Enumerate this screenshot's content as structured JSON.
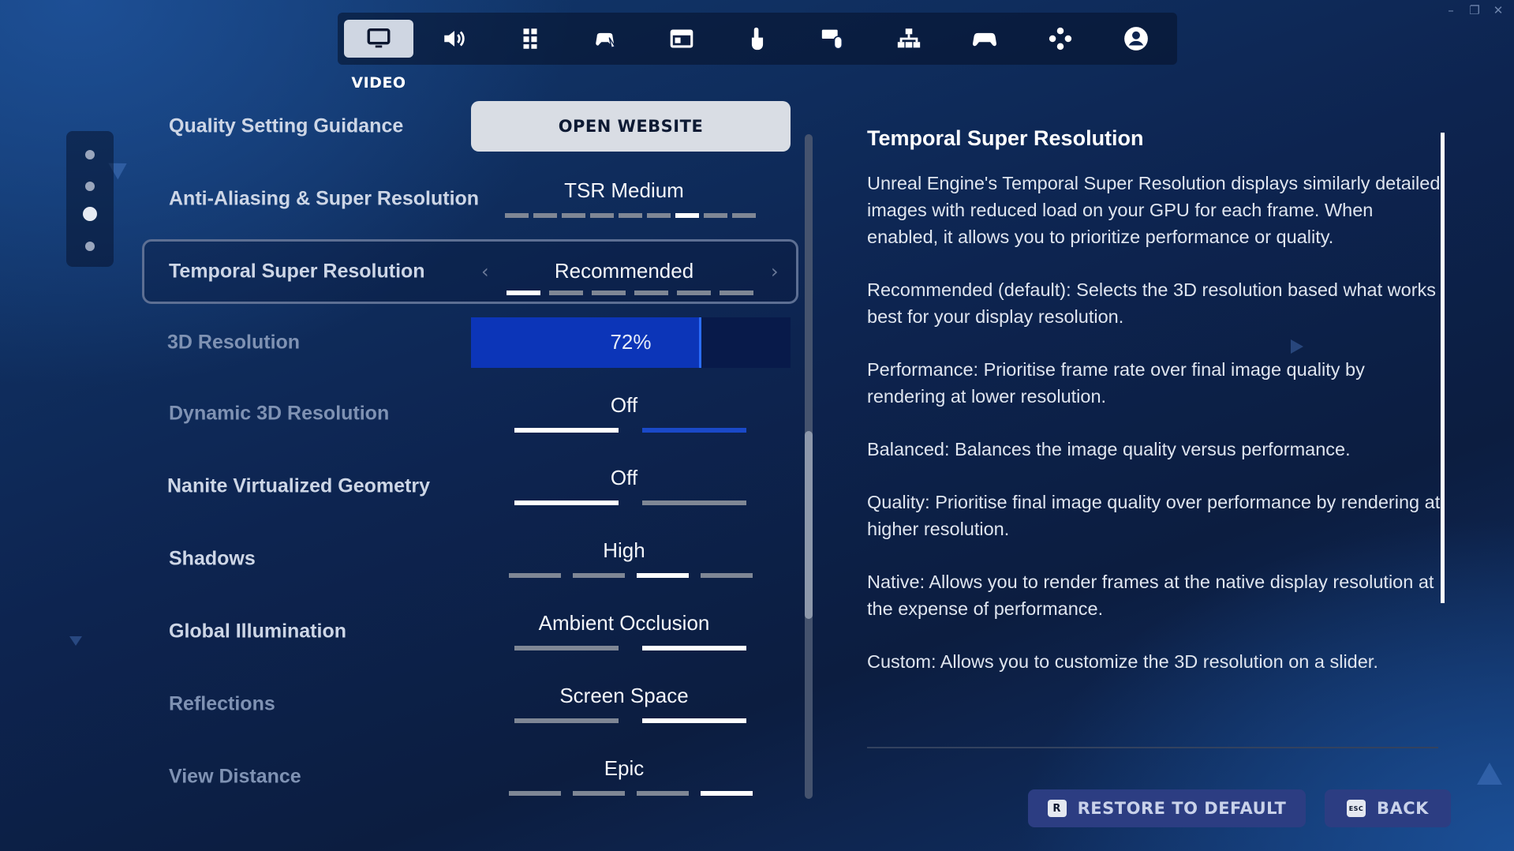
{
  "window": {
    "minimize_glyph": "–",
    "restore_glyph": "❐",
    "close_glyph": "✕"
  },
  "tabs": [
    {
      "icon": "monitor-icon",
      "active": true
    },
    {
      "icon": "speaker-icon"
    },
    {
      "icon": "accessibility-grid-icon"
    },
    {
      "icon": "gamepad-touch-icon"
    },
    {
      "icon": "window-panel-icon"
    },
    {
      "icon": "touch-hand-icon"
    },
    {
      "icon": "keyboard-mouse-icon"
    },
    {
      "icon": "network-icon"
    },
    {
      "icon": "controller-icon"
    },
    {
      "icon": "controller-dpad-icon"
    },
    {
      "icon": "account-icon"
    }
  ],
  "active_tab_label": "VIDEO",
  "settings": {
    "quality_guidance": {
      "label": "Quality Setting Guidance",
      "button": "OPEN WEBSITE"
    },
    "anti_aliasing": {
      "label": "Anti-Aliasing & Super Resolution",
      "value": "TSR Medium",
      "options": 9,
      "selected": 6
    },
    "tsr": {
      "label": "Temporal Super Resolution",
      "value": "Recommended",
      "options": 6,
      "selected": 0
    },
    "resolution_3d": {
      "label": "3D Resolution",
      "value": "72%",
      "percent": 72
    },
    "dynamic_3d": {
      "label": "Dynamic 3D Resolution",
      "value": "Off",
      "options": 2,
      "selected": 0
    },
    "nanite": {
      "label": "Nanite Virtualized Geometry",
      "value": "Off",
      "options": 2,
      "selected": 0
    },
    "shadows": {
      "label": "Shadows",
      "value": "High",
      "options": 4,
      "selected": 2
    },
    "global_illumination": {
      "label": "Global Illumination",
      "value": "Ambient Occlusion",
      "options": 2,
      "selected": 1
    },
    "reflections": {
      "label": "Reflections",
      "value": "Screen Space",
      "options": 2,
      "selected": 1
    },
    "view_distance": {
      "label": "View Distance",
      "value": "Epic",
      "options": 4,
      "selected": 3
    }
  },
  "description": {
    "title": "Temporal Super Resolution",
    "paragraphs": [
      "Unreal Engine's Temporal Super Resolution displays similarly detailed images with reduced load on your GPU for each frame. When enabled, it allows you to prioritize performance or quality.",
      "Recommended (default): Selects the 3D resolution based what works best for your display resolution.",
      "Performance: Prioritise frame rate over final image quality by rendering at lower resolution.",
      "Balanced: Balances the image quality versus performance.",
      "Quality: Prioritise final image quality over performance by rendering at higher resolution.",
      "Native: Allows you to render frames at the native display resolution at the expense of performance.",
      "Custom: Allows you to customize the 3D resolution on a slider."
    ]
  },
  "footer": {
    "restore_key": "R",
    "restore_label": "RESTORE TO DEFAULT",
    "back_key": "ESC",
    "back_label": "BACK"
  },
  "colors": {
    "accent_blue": "#0c35b8",
    "slider_track": "#081a4a",
    "button_bg": "#2c3d82"
  }
}
